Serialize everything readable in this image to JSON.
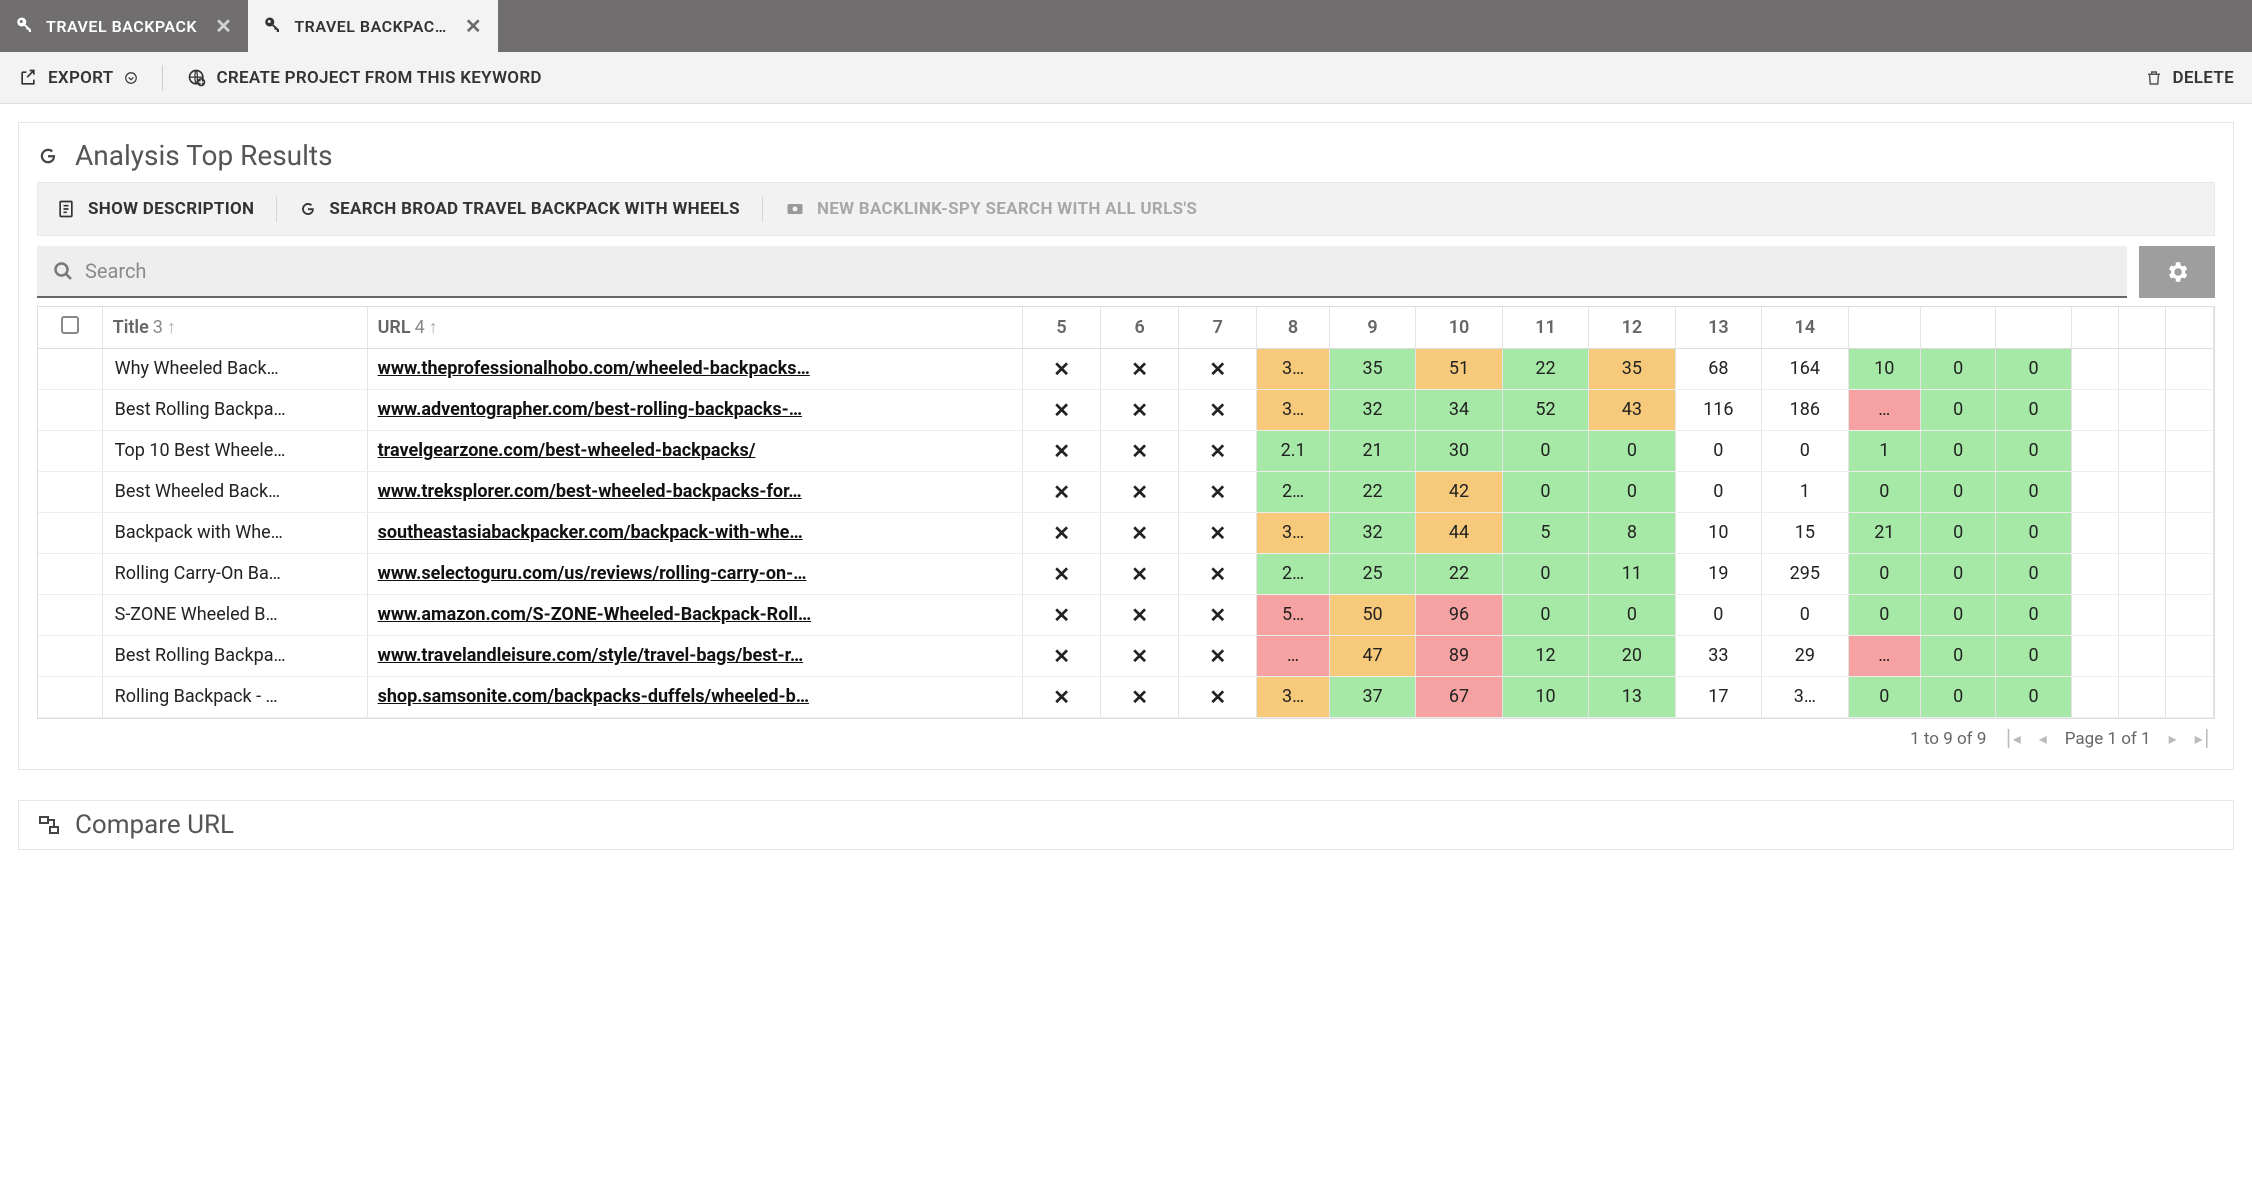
{
  "tabs": [
    {
      "label": "TRAVEL BACKPACK",
      "active": false
    },
    {
      "label": "TRAVEL BACKPAC…",
      "active": true
    }
  ],
  "actions": {
    "export": "EXPORT",
    "create": "CREATE PROJECT FROM THIS KEYWORD",
    "delete": "DELETE"
  },
  "panel": {
    "title": "Analysis Top Results",
    "toolbar": {
      "show_desc": "SHOW DESCRIPTION",
      "search_broad": "SEARCH BROAD TRAVEL BACKPACK WITH WHEELS",
      "backlink": "NEW BACKLINK-SPY SEARCH WITH ALL URLS'S"
    },
    "search_placeholder": "Search"
  },
  "columns": {
    "title": {
      "label": "Title",
      "ord": "3"
    },
    "url": {
      "label": "URL",
      "ord": "4"
    },
    "c5": "5",
    "c6": "6",
    "c7": "7",
    "c8": "8",
    "c9": "9",
    "c10": "10",
    "c11": "11",
    "c12": "12",
    "c13": "13",
    "c14": "14"
  },
  "rows": [
    {
      "title": "Why Wheeled Back…",
      "url": "www.theprofessionalhobo.com/wheeled-backpacks…",
      "m": [
        true,
        true,
        true
      ],
      "v": [
        {
          "t": "3…",
          "c": "orange"
        },
        {
          "t": "35",
          "c": "green"
        },
        {
          "t": "51",
          "c": "orange"
        },
        {
          "t": "22",
          "c": "green"
        },
        {
          "t": "35",
          "c": "orange"
        },
        {
          "t": "68",
          "c": ""
        },
        {
          "t": "164",
          "c": ""
        },
        {
          "t": "10",
          "c": "green"
        },
        {
          "t": "0",
          "c": "green"
        },
        {
          "t": "0",
          "c": "green"
        }
      ]
    },
    {
      "title": "Best Rolling Backpa…",
      "url": "www.adventographer.com/best-rolling-backpacks-…",
      "m": [
        true,
        true,
        true
      ],
      "v": [
        {
          "t": "3…",
          "c": "orange"
        },
        {
          "t": "32",
          "c": "green"
        },
        {
          "t": "34",
          "c": "green"
        },
        {
          "t": "52",
          "c": "green"
        },
        {
          "t": "43",
          "c": "orange"
        },
        {
          "t": "116",
          "c": ""
        },
        {
          "t": "186",
          "c": ""
        },
        {
          "t": "…",
          "c": "red"
        },
        {
          "t": "0",
          "c": "green"
        },
        {
          "t": "0",
          "c": "green"
        }
      ]
    },
    {
      "title": "Top 10 Best Wheele…",
      "url": "travelgearzone.com/best-wheeled-backpacks/",
      "m": [
        true,
        true,
        true
      ],
      "v": [
        {
          "t": "2.1",
          "c": "green"
        },
        {
          "t": "21",
          "c": "green"
        },
        {
          "t": "30",
          "c": "green"
        },
        {
          "t": "0",
          "c": "green"
        },
        {
          "t": "0",
          "c": "green"
        },
        {
          "t": "0",
          "c": ""
        },
        {
          "t": "0",
          "c": ""
        },
        {
          "t": "1",
          "c": "green"
        },
        {
          "t": "0",
          "c": "green"
        },
        {
          "t": "0",
          "c": "green"
        }
      ]
    },
    {
      "title": "Best Wheeled Back…",
      "url": "www.treksplorer.com/best-wheeled-backpacks-for…",
      "m": [
        true,
        true,
        true
      ],
      "v": [
        {
          "t": "2…",
          "c": "green"
        },
        {
          "t": "22",
          "c": "green"
        },
        {
          "t": "42",
          "c": "orange"
        },
        {
          "t": "0",
          "c": "green"
        },
        {
          "t": "0",
          "c": "green"
        },
        {
          "t": "0",
          "c": ""
        },
        {
          "t": "1",
          "c": ""
        },
        {
          "t": "0",
          "c": "green"
        },
        {
          "t": "0",
          "c": "green"
        },
        {
          "t": "0",
          "c": "green"
        }
      ]
    },
    {
      "title": "Backpack with Whe…",
      "url": "southeastasiabackpacker.com/backpack-with-whe…",
      "m": [
        true,
        true,
        true
      ],
      "v": [
        {
          "t": "3…",
          "c": "orange"
        },
        {
          "t": "32",
          "c": "green"
        },
        {
          "t": "44",
          "c": "orange"
        },
        {
          "t": "5",
          "c": "green"
        },
        {
          "t": "8",
          "c": "green"
        },
        {
          "t": "10",
          "c": ""
        },
        {
          "t": "15",
          "c": ""
        },
        {
          "t": "21",
          "c": "green"
        },
        {
          "t": "0",
          "c": "green"
        },
        {
          "t": "0",
          "c": "green"
        }
      ]
    },
    {
      "title": "Rolling Carry-On Ba…",
      "url": "www.selectoguru.com/us/reviews/rolling-carry-on-…",
      "m": [
        true,
        true,
        true
      ],
      "v": [
        {
          "t": "2…",
          "c": "green"
        },
        {
          "t": "25",
          "c": "green"
        },
        {
          "t": "22",
          "c": "green"
        },
        {
          "t": "0",
          "c": "green"
        },
        {
          "t": "11",
          "c": "green"
        },
        {
          "t": "19",
          "c": ""
        },
        {
          "t": "295",
          "c": ""
        },
        {
          "t": "0",
          "c": "green"
        },
        {
          "t": "0",
          "c": "green"
        },
        {
          "t": "0",
          "c": "green"
        }
      ]
    },
    {
      "title": "S-ZONE Wheeled B…",
      "url": "www.amazon.com/S-ZONE-Wheeled-Backpack-Roll…",
      "m": [
        true,
        true,
        true
      ],
      "v": [
        {
          "t": "5…",
          "c": "red"
        },
        {
          "t": "50",
          "c": "orange"
        },
        {
          "t": "96",
          "c": "red"
        },
        {
          "t": "0",
          "c": "green"
        },
        {
          "t": "0",
          "c": "green"
        },
        {
          "t": "0",
          "c": ""
        },
        {
          "t": "0",
          "c": ""
        },
        {
          "t": "0",
          "c": "green"
        },
        {
          "t": "0",
          "c": "green"
        },
        {
          "t": "0",
          "c": "green"
        }
      ]
    },
    {
      "title": "Best Rolling Backpa…",
      "url": "www.travelandleisure.com/style/travel-bags/best-r…",
      "m": [
        true,
        true,
        true
      ],
      "v": [
        {
          "t": "…",
          "c": "red"
        },
        {
          "t": "47",
          "c": "orange"
        },
        {
          "t": "89",
          "c": "red"
        },
        {
          "t": "12",
          "c": "green"
        },
        {
          "t": "20",
          "c": "green"
        },
        {
          "t": "33",
          "c": ""
        },
        {
          "t": "29",
          "c": ""
        },
        {
          "t": "…",
          "c": "red"
        },
        {
          "t": "0",
          "c": "green"
        },
        {
          "t": "0",
          "c": "green"
        }
      ]
    },
    {
      "title": "Rolling Backpack - …",
      "url": "shop.samsonite.com/backpacks-duffels/wheeled-b…",
      "m": [
        true,
        true,
        true
      ],
      "v": [
        {
          "t": "3…",
          "c": "orange"
        },
        {
          "t": "37",
          "c": "green"
        },
        {
          "t": "67",
          "c": "red"
        },
        {
          "t": "10",
          "c": "green"
        },
        {
          "t": "13",
          "c": "green"
        },
        {
          "t": "17",
          "c": ""
        },
        {
          "t": "3…",
          "c": ""
        },
        {
          "t": "0",
          "c": "green"
        },
        {
          "t": "0",
          "c": "green"
        },
        {
          "t": "0",
          "c": "green"
        }
      ]
    }
  ],
  "pager": {
    "range": "1 to 9 of 9",
    "page": "Page 1 of 1"
  },
  "section2": {
    "title": "Compare URL"
  }
}
